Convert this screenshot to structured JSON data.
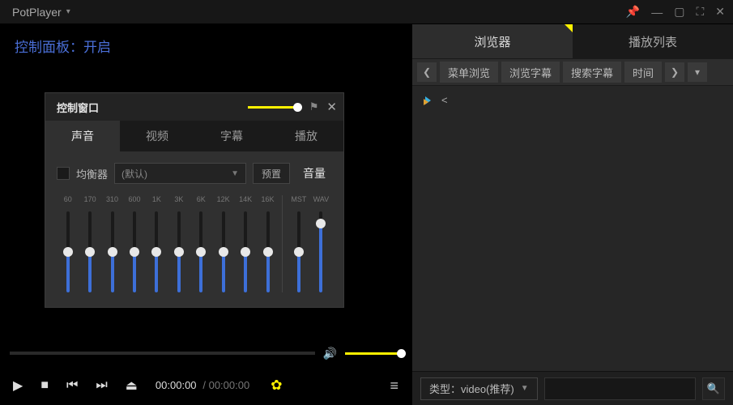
{
  "title": "PotPlayer",
  "banner": "控制面板：开启",
  "ctrl": {
    "title": "控制窗口",
    "tabs": [
      "声音",
      "视频",
      "字幕",
      "播放"
    ],
    "eq_label": "均衡器",
    "preset": "(默认)",
    "preset_btn": "预置",
    "volume_label": "音量",
    "bands": [
      "60",
      "170",
      "310",
      "600",
      "1K",
      "3K",
      "6K",
      "12K",
      "14K",
      "16K"
    ],
    "mst": "MST",
    "wav": "WAV",
    "band_fill": 50,
    "vol_fill": 85
  },
  "time_current": "00:00:00",
  "time_total": "00:00:00",
  "right": {
    "tabs": [
      "浏览器",
      "播放列表"
    ],
    "toolbar": {
      "menu": "菜单浏览",
      "subtitle": "浏览字幕",
      "search_sub": "搜索字幕",
      "time": "时间"
    },
    "item": "<",
    "type_label": "类型：",
    "type_value": "video(推荐)"
  }
}
